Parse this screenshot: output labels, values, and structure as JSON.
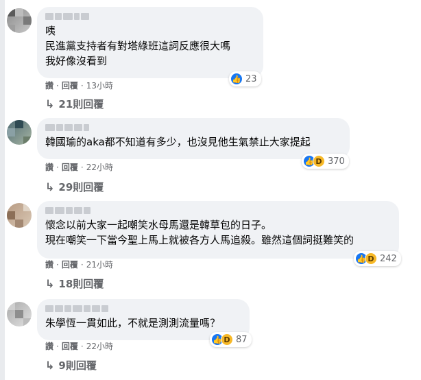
{
  "comments": [
    {
      "lines": [
        "咦",
        "民進黨支持者有對塔綠班這詞反應很大嗎",
        "我好像沒看到"
      ],
      "reactions": {
        "icons": [
          "like"
        ],
        "count": "23"
      },
      "meta": {
        "like": "讚",
        "reply": "回覆",
        "time": "13小時"
      },
      "replies": "21則回覆"
    },
    {
      "lines": [
        "韓國瑜的aka都不知道有多少，也沒見他生氣禁止大家提起"
      ],
      "reactions": {
        "icons": [
          "like",
          "haha"
        ],
        "count": "370"
      },
      "meta": {
        "like": "讚",
        "reply": "回覆",
        "time": "22小時"
      },
      "replies": "29則回覆"
    },
    {
      "lines": [
        "懷念以前大家一起嘲笑水母馬還是韓草包的日子。",
        "現在嘲笑一下當今聖上馬上就被各方人馬追殺。雖然這個詞挺難笑的"
      ],
      "reactions": {
        "icons": [
          "like",
          "haha"
        ],
        "count": "242"
      },
      "meta": {
        "like": "讚",
        "reply": "回覆",
        "time": "21小時"
      },
      "replies": "18則回覆"
    },
    {
      "lines": [
        "朱學恆一貫如此，不就是測測流量嗎？"
      ],
      "reactions": {
        "icons": [
          "like",
          "haha"
        ],
        "count": "87"
      },
      "meta": {
        "like": "讚",
        "reply": "回覆",
        "time": "22小時"
      },
      "replies": "9則回覆"
    }
  ],
  "icons": {
    "reply_arrow": "reply-arrow-icon",
    "like": "thumbs-up-icon",
    "haha": "laughing-face-icon"
  },
  "colors": {
    "bubble": "#f0f2f5",
    "meta_text": "#65676b",
    "like_blue": "#1877f2",
    "haha_yellow": "#f7b928"
  }
}
